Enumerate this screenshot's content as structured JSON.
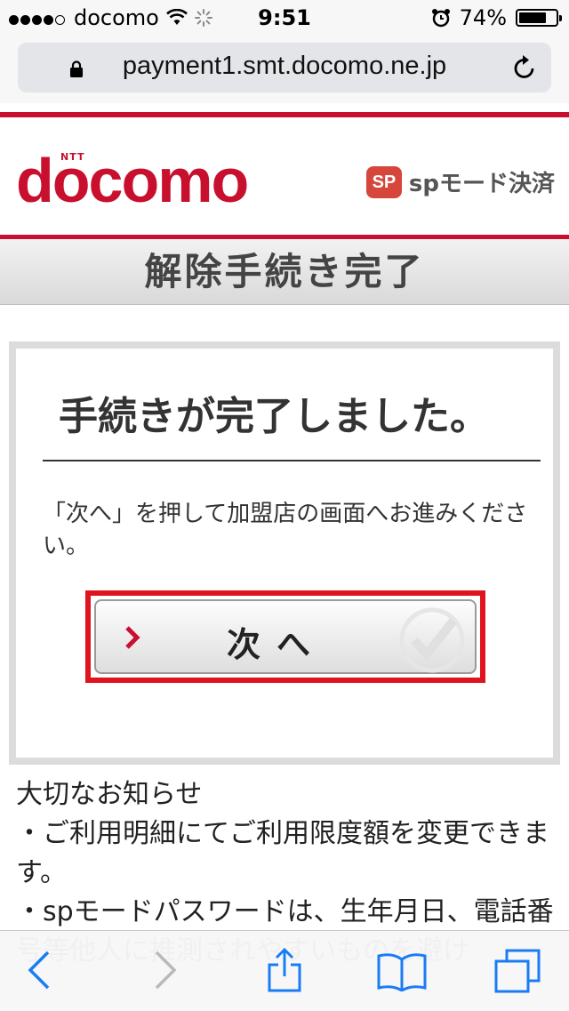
{
  "status_bar": {
    "carrier": "docomo",
    "time": "9:51",
    "battery": "74%",
    "battery_level": 0.74
  },
  "address_bar": {
    "url": "payment1.smt.docomo.ne.jp"
  },
  "header": {
    "logo_small": "NTT",
    "logo": "docomo",
    "sp_badge": "SP",
    "sp_label": "spモード決済"
  },
  "title_bar": {
    "title": "解除手続き完了"
  },
  "card": {
    "heading": "手続きが完了しました。",
    "message": "「次へ」を押して加盟店の画面へお進みください。",
    "next_button": "次へ"
  },
  "notice": {
    "heading": "大切なお知らせ",
    "items": [
      "・ご利用明細にてご利用限度額を変更できます。",
      "・spモードパスワードは、生年月日、電話番号等他人に推測されやすいものを避け"
    ]
  },
  "toolbar": {
    "icons": [
      "back-icon",
      "forward-icon",
      "share-icon",
      "bookmarks-icon",
      "tabs-icon"
    ]
  },
  "colors": {
    "docomo_red": "#c8102e",
    "highlight_red": "#e0141e",
    "ios_blue": "#1a7cf5"
  }
}
